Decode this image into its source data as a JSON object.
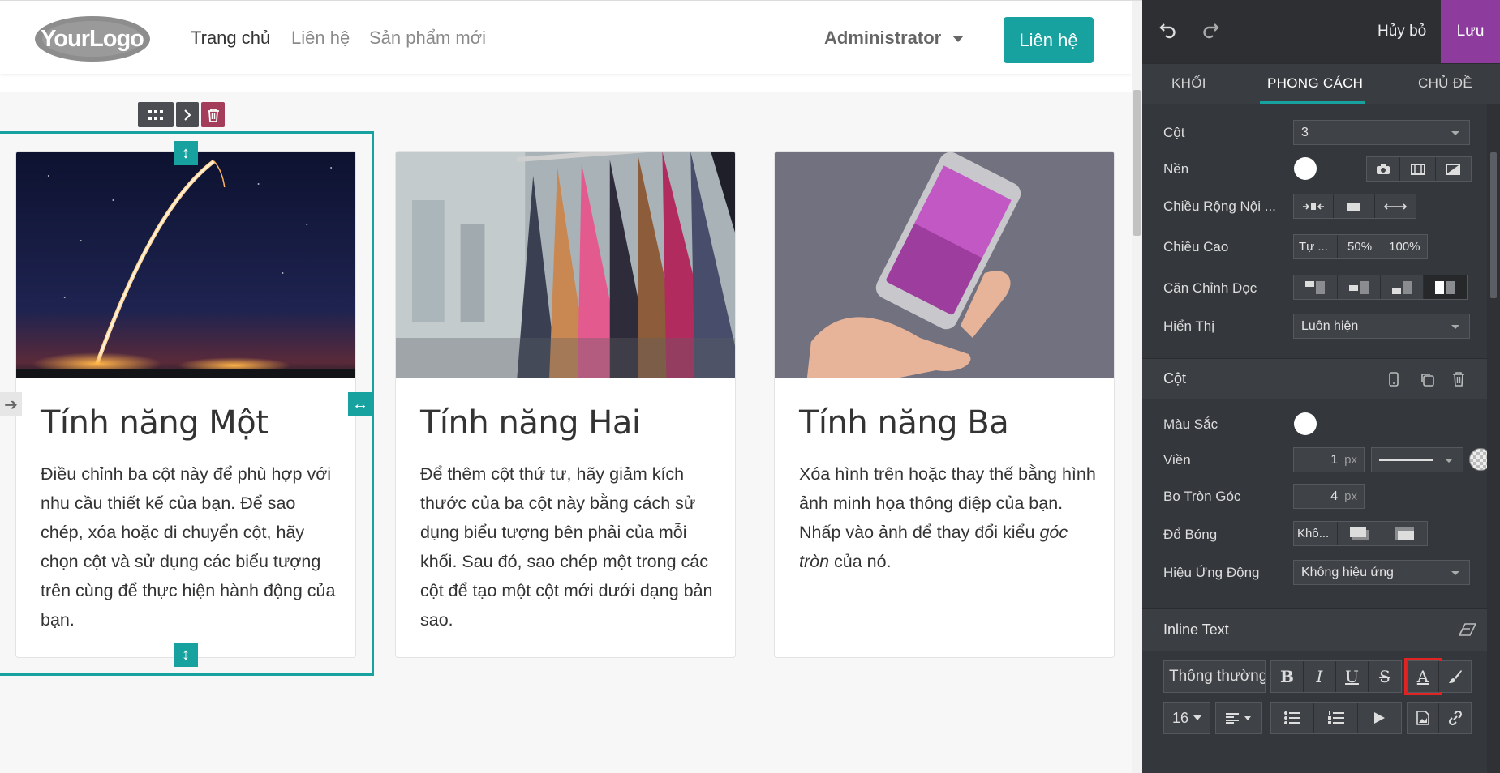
{
  "header": {
    "logo_text": "YourLogo",
    "nav": [
      {
        "label": "Trang chủ",
        "active": true
      },
      {
        "label": "Liên hệ",
        "active": false
      },
      {
        "label": "Sản phẩm mới",
        "active": false
      }
    ],
    "user": "Administrator",
    "cta": "Liên hệ"
  },
  "cards": [
    {
      "title": "Tính năng Một",
      "body": "Điều chỉnh ba cột này để phù hợp với nhu cầu thiết kế của bạn. Để sao chép, xóa hoặc di chuyển cột, hãy chọn cột và sử dụng các biểu tượng trên cùng để thực hiện hành động của bạn.",
      "image": "rocket-launch"
    },
    {
      "title": "Tính năng Hai",
      "body": "Để thêm cột thứ tư, hãy giảm kích thước của ba cột này bằng cách sử dụng biểu tượng bên phải của mỗi khối. Sau đó, sao chép một trong các cột để tạo một cột mới dưới dạng bản sao.",
      "image": "clothes-rack"
    },
    {
      "title": "Tính năng Ba",
      "body_parts": [
        "Xóa hình trên hoặc thay thế bằng hình ảnh minh họa thông điệp của bạn. Nhấp vào ảnh để thay đổi kiểu ",
        "góc tròn",
        " của nó."
      ],
      "image": "phone-in-hand"
    }
  ],
  "panel": {
    "cancel": "Hủy bỏ",
    "save": "Lưu",
    "tabs": [
      "KHỐI",
      "PHONG CÁCH",
      "CHỦ ĐỀ"
    ],
    "active_tab": "PHONG CÁCH",
    "snippet": {
      "columns_label": "Cột",
      "columns_value": "3",
      "background_label": "Nền",
      "content_width_label": "Chiều Rộng Nội ...",
      "height_label": "Chiều Cao",
      "height_options": [
        "Tự ...",
        "50%",
        "100%"
      ],
      "vertical_align_label": "Căn Chỉnh Dọc",
      "display_label": "Hiển Thị",
      "display_value": "Luôn hiện"
    },
    "column": {
      "title": "Cột",
      "color_label": "Màu Sắc",
      "border_label": "Viền",
      "border_value": "1",
      "radius_label": "Bo Tròn Góc",
      "radius_value": "4",
      "unit": "px",
      "shadow_label": "Đổ Bóng",
      "shadow_value": "Khô...",
      "animation_label": "Hiệu Ứng Động",
      "animation_value": "Không hiệu ứng"
    },
    "inline_text": {
      "title": "Inline Text",
      "style_value": "Thông thường",
      "font_size": "16",
      "highlighted_tool": "text-color"
    }
  },
  "colors": {
    "accent": "#17a2a0",
    "save": "#8d3c9e",
    "panel_bg": "#34373b",
    "delete": "#a33d5a",
    "highlight_box": "#e02424"
  }
}
